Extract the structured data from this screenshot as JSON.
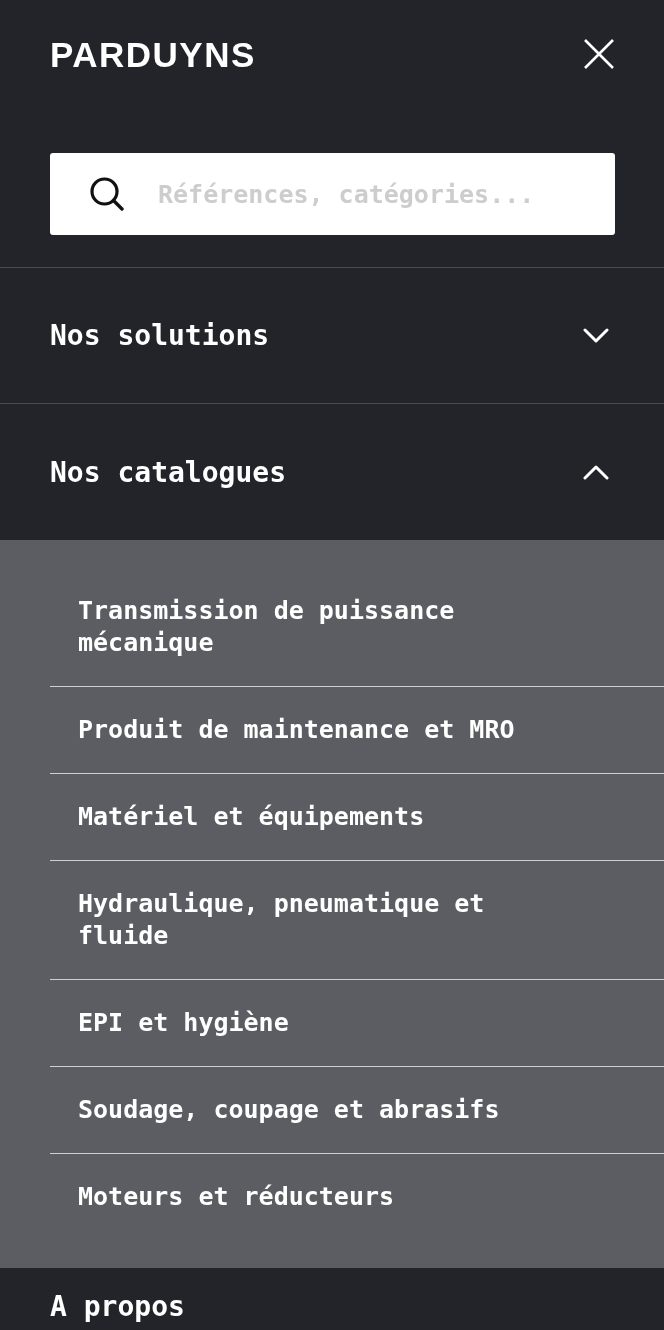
{
  "logo": "PARDUYNS",
  "search": {
    "placeholder": "Références, catégories..."
  },
  "sections": [
    {
      "label": "Nos solutions",
      "expanded": false
    },
    {
      "label": "Nos catalogues",
      "expanded": true,
      "items": [
        "Transmission de puissance mécanique",
        "Produit de maintenance et MRO",
        "Matériel et équipements",
        "Hydraulique, pneumatique et fluide",
        "EPI et hygiène",
        "Soudage, coupage et abrasifs",
        "Moteurs et réducteurs"
      ]
    }
  ],
  "next_section": {
    "label": "A propos"
  }
}
